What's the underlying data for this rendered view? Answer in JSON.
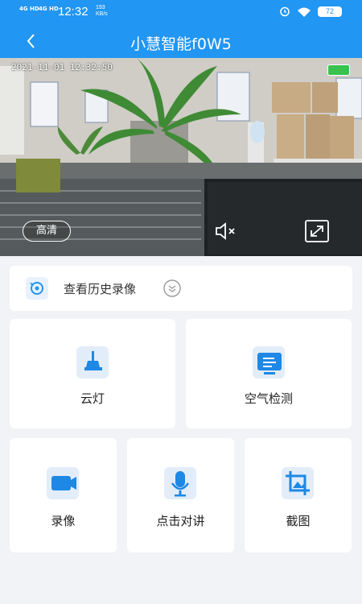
{
  "statusbar": {
    "net1": "4G HD",
    "net2": "4G HD",
    "time": "12:32",
    "speed_value": "193",
    "speed_unit": "KB/s",
    "battery": "72"
  },
  "header": {
    "title": "小慧智能f0W5"
  },
  "video": {
    "timestamp": "2021-11-01  12:32:50",
    "quality": "高清"
  },
  "history": {
    "label": "查看历史录像"
  },
  "tiles_top": [
    {
      "label": "云灯",
      "icon": "lamp-icon"
    },
    {
      "label": "空气检测",
      "icon": "air-detect-icon"
    }
  ],
  "tiles_bottom": [
    {
      "label": "录像",
      "icon": "video-camera-icon"
    },
    {
      "label": "点击对讲",
      "icon": "microphone-icon"
    },
    {
      "label": "截图",
      "icon": "crop-icon"
    }
  ],
  "colors": {
    "primary": "#2196f3",
    "background": "#f1f3f6"
  }
}
